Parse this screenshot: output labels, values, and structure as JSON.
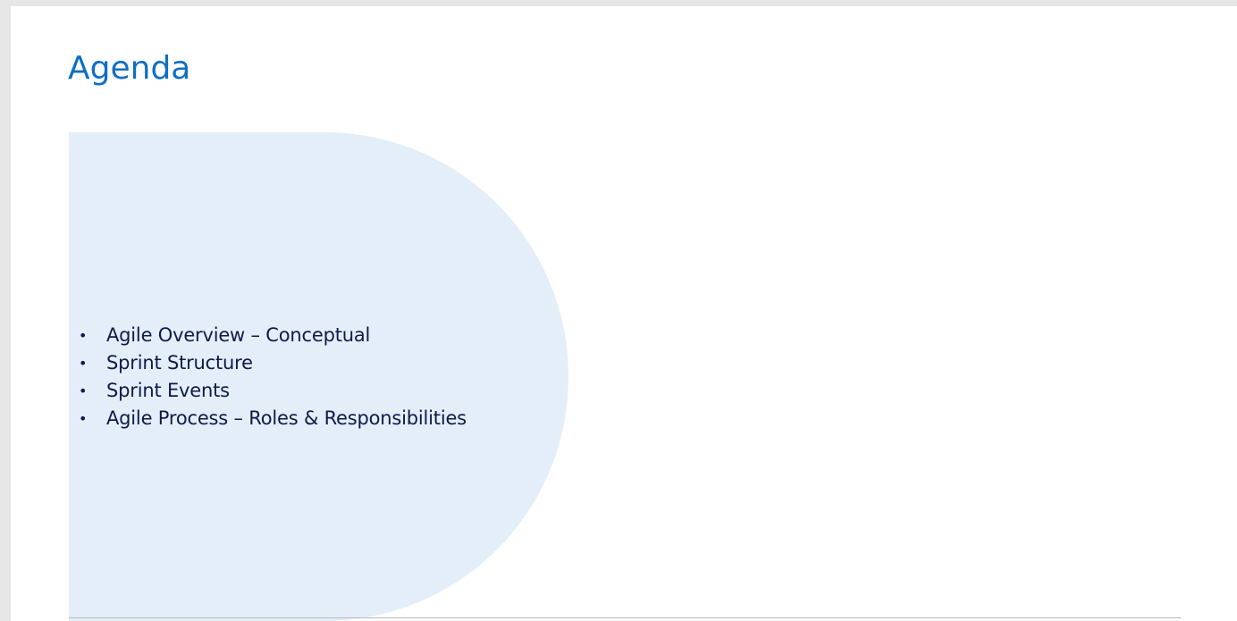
{
  "theme": {
    "title_color": "#0f6fc6",
    "shape_color": "#e3eef9",
    "text_color": "#0d1b4a"
  },
  "slide": {
    "title": "Agenda",
    "agenda_items": [
      "Agile Overview – Conceptual",
      "Sprint Structure",
      "Sprint Events",
      "Agile Process – Roles & Responsibilities"
    ],
    "bullet_glyph": "•"
  }
}
